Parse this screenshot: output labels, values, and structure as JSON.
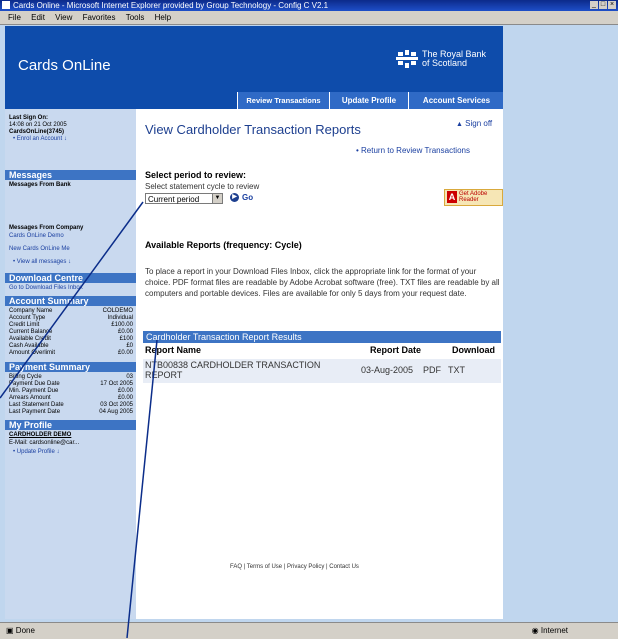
{
  "window": {
    "title": "Cards Online - Microsoft Internet Explorer provided by Group Technology - Config C V2.1",
    "menu": [
      "File",
      "Edit",
      "View",
      "Favorites",
      "Tools",
      "Help"
    ]
  },
  "header": {
    "brand": "Cards OnLine",
    "bank_line1": "The Royal Bank",
    "bank_line2": "of Scotland"
  },
  "tabs": {
    "review": "Review Transactions",
    "profile": "Update Profile",
    "account": "Account Services"
  },
  "sidebar": {
    "last_sign_on_label": "Last Sign On:",
    "last_sign_on_value": "14:08 on 21 Oct 2005",
    "cardsonline_id": "CardsOnLine(3745)",
    "enrol_link": "Enrol an Account",
    "messages_head": "Messages",
    "messages_from_bank": "Messages From Bank",
    "messages_from_company": "Messages From Company",
    "company_demo": "Cards OnLine Demo",
    "new_cards_msg": "New Cards OnLine Me",
    "view_all": "View all messages",
    "download_head": "Download Centre",
    "download_link": "Go to Download Files Inbox",
    "account_head": "Account Summary",
    "account_rows": [
      {
        "k": "Company Name",
        "v": "COLDEMO"
      },
      {
        "k": "Account Type",
        "v": "Individual"
      },
      {
        "k": "Credit Limit",
        "v": "£100.00"
      },
      {
        "k": "Current Balance",
        "v": "£0.00"
      },
      {
        "k": "Available Credit",
        "v": "£100"
      },
      {
        "k": "Cash Available",
        "v": "£0"
      },
      {
        "k": "Amount Overlimit",
        "v": "£0.00"
      }
    ],
    "payment_head": "Payment Summary",
    "payment_rows": [
      {
        "k": "Billing Cycle",
        "v": "03"
      },
      {
        "k": "Payment Due Date",
        "v": "17 Oct 2005"
      },
      {
        "k": "Min. Payment Due",
        "v": "£0.00"
      },
      {
        "k": "Arrears Amount",
        "v": "£0.00"
      },
      {
        "k": "Last Statement Date",
        "v": "03 Oct 2005"
      },
      {
        "k": "Last Payment Date",
        "v": "04 Aug 2005"
      }
    ],
    "profile_head": "My Profile",
    "profile_name": "CARDHOLDER DEMO",
    "profile_email": "E-Mail: cardsonline@car...",
    "update_profile": "Update Profile"
  },
  "main": {
    "title": "View Cardholder Transaction Reports",
    "sign_off": "Sign off",
    "return_link": "Return to Review Transactions",
    "period_heading": "Select period to review:",
    "period_sub": "Select statement cycle to review",
    "period_selected": "Current period",
    "go": "Go",
    "adobe_line1": "Get Adobe",
    "adobe_line2": "Reader",
    "avail_heading": "Available Reports (frequency: Cycle)",
    "avail_desc": "To place a report in your Download Files Inbox, click the appropriate link for the format of your choice. PDF format files are readable by Adobe Acrobat software (free). TXT files are readable by all computers and portable devices. Files are available for only 5 days from your request date.",
    "results_head": "Cardholder Transaction Report Results",
    "col_name": "Report Name",
    "col_date": "Report Date",
    "col_download": "Download",
    "row_name": "NTB00838 CARDHOLDER TRANSACTION REPORT",
    "row_date": "03-Aug-2005",
    "row_pdf": "PDF",
    "row_txt": "TXT",
    "footer": "FAQ | Terms of Use | Privacy Policy | Contact Us"
  },
  "status": {
    "left": "Done",
    "zone": "Internet"
  }
}
